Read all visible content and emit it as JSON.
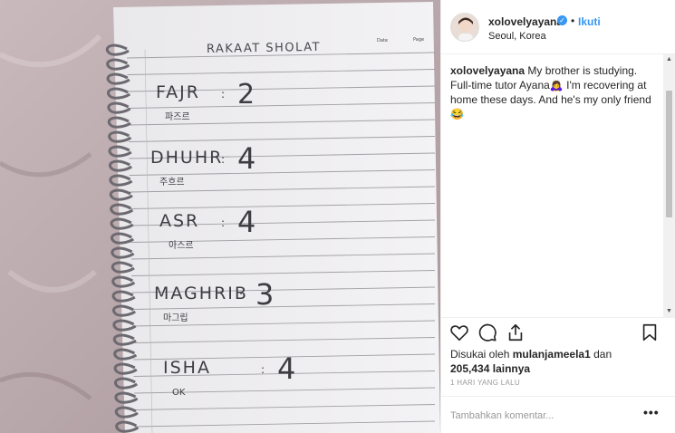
{
  "header": {
    "username": "xolovelyayana",
    "verified_icon": "verified-badge-icon",
    "separator": "•",
    "follow_label": "Ikuti",
    "location": "Seoul, Korea"
  },
  "caption": {
    "username": "xolovelyayana",
    "text": "My brother is studying. Full-time tutor Ayana🙇‍♀️ I'm recovering at home these days. And he's my only friend 😂"
  },
  "actions": {
    "icons": [
      "heart-icon",
      "comment-icon",
      "share-icon",
      "bookmark-icon"
    ],
    "liked_by_prefix": "Disukai oleh",
    "liked_by_user": "mulanjameela1",
    "liked_by_and": "dan",
    "others_count": "205,434",
    "others_suffix": "lainnya",
    "timestamp": "1 HARI YANG LALU"
  },
  "comment": {
    "placeholder": "Tambahkan komentar...",
    "more_label": "•••"
  },
  "photo": {
    "notebook_title": "RAKAAT SHOLAT",
    "header_date": "Date",
    "header_page": "Page",
    "entries": [
      {
        "prayer": "FAJR",
        "count": "2",
        "korean": "파즈르"
      },
      {
        "prayer": "DHUHR",
        "count": "4",
        "korean": "주흐르"
      },
      {
        "prayer": "ASR",
        "count": "4",
        "korean": "아스르"
      },
      {
        "prayer": "MAGHRIB",
        "count": "3",
        "korean": "마그립"
      },
      {
        "prayer": "ISHA",
        "count": "4",
        "korean": "OK"
      }
    ]
  }
}
